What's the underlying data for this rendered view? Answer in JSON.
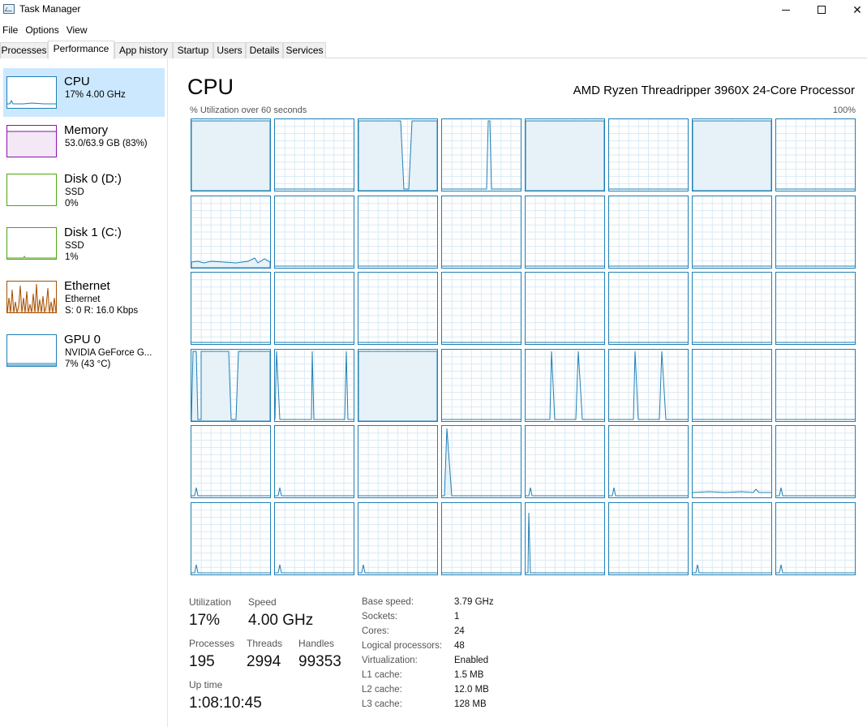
{
  "window": {
    "title": "Task Manager"
  },
  "menu": [
    "File",
    "Options",
    "View"
  ],
  "tabs": [
    "Processes",
    "Performance",
    "App history",
    "Startup",
    "Users",
    "Details",
    "Services"
  ],
  "sidebar": [
    {
      "name": "CPU",
      "sub1": "17%  4.00 GHz",
      "sub2": "",
      "sub3": ""
    },
    {
      "name": "Memory",
      "sub1": "53.0/63.9 GB (83%)",
      "sub2": "",
      "sub3": ""
    },
    {
      "name": "Disk 0 (D:)",
      "sub1": "SSD",
      "sub2": "0%",
      "sub3": ""
    },
    {
      "name": "Disk 1 (C:)",
      "sub1": "SSD",
      "sub2": "1%",
      "sub3": ""
    },
    {
      "name": "Ethernet",
      "sub1": "Ethernet",
      "sub2": "S: 0  R: 16.0 Kbps",
      "sub3": ""
    },
    {
      "name": "GPU 0",
      "sub1": "NVIDIA GeForce G...",
      "sub2": "7%  (43 °C)",
      "sub3": ""
    }
  ],
  "main": {
    "title": "CPU",
    "processor": "AMD Ryzen Threadripper 3960X 24-Core Processor",
    "graph_label": "% Utilization over 60 seconds",
    "graph_max": "100%"
  },
  "stats": {
    "utilization_label": "Utilization",
    "utilization": "17%",
    "speed_label": "Speed",
    "speed": "4.00 GHz",
    "processes_label": "Processes",
    "processes": "195",
    "threads_label": "Threads",
    "threads": "2994",
    "handles_label": "Handles",
    "handles": "99353",
    "uptime_label": "Up time",
    "uptime": "1:08:10:45"
  },
  "details": [
    {
      "key": "Base speed:",
      "value": "3.79 GHz"
    },
    {
      "key": "Sockets:",
      "value": "1"
    },
    {
      "key": "Cores:",
      "value": "24"
    },
    {
      "key": "Logical processors:",
      "value": "48"
    },
    {
      "key": "Virtualization:",
      "value": "Enabled"
    },
    {
      "key": "L1 cache:",
      "value": "1.5 MB"
    },
    {
      "key": "L2 cache:",
      "value": "12.0 MB"
    },
    {
      "key": "L3 cache:",
      "value": "128 MB"
    }
  ],
  "colors": {
    "cpu": "#1f7fb5",
    "cpu_fill": "#e6f1f8",
    "memory": "#8b12ae",
    "disk": "#4da60c",
    "ethernet": "#a74f01",
    "selected_bg": "#cce8ff"
  }
}
